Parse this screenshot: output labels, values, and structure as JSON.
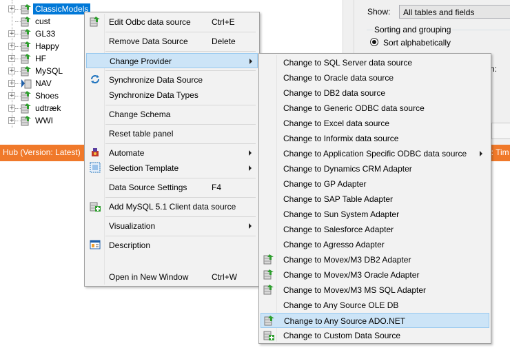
{
  "tree": {
    "items": [
      {
        "label": "ClassicModels",
        "expander": "+",
        "selected": true
      },
      {
        "label": "cust",
        "expander": "",
        "selected": false
      },
      {
        "label": "GL33",
        "expander": "+",
        "selected": false
      },
      {
        "label": "Happy",
        "expander": "+",
        "selected": false
      },
      {
        "label": "HF",
        "expander": "+",
        "selected": false
      },
      {
        "label": "MySQL",
        "expander": "+",
        "selected": false
      },
      {
        "label": "NAV",
        "expander": "+",
        "selected": false
      },
      {
        "label": "Shoes",
        "expander": "+",
        "selected": false
      },
      {
        "label": "udtræk",
        "expander": "+",
        "selected": false
      },
      {
        "label": "WWI",
        "expander": "+",
        "selected": false
      }
    ]
  },
  "right_panel": {
    "show_label": "Show:",
    "show_value": "All tables and fields",
    "sort_group_label": "Sorting and grouping",
    "sort_option": "Sort alphabetically",
    "clipped_text": "n:"
  },
  "status": {
    "left_text": "Hub (Version: Latest)",
    "right_text": "o: Tim"
  },
  "context_menu": {
    "items": [
      {
        "label": "Edit Odbc data source",
        "shortcut": "Ctrl+E",
        "icon": "edit-datasource-icon",
        "submenu": false
      },
      {
        "label": "Remove Data Source",
        "shortcut": "Delete",
        "icon": "",
        "submenu": false
      },
      {
        "label": "Change Provider",
        "shortcut": "",
        "icon": "",
        "submenu": true,
        "highlight": true
      },
      {
        "label": "Synchronize Data Source",
        "shortcut": "",
        "icon": "sync-icon",
        "submenu": false
      },
      {
        "label": "Synchronize Data Types",
        "shortcut": "",
        "icon": "",
        "submenu": false
      },
      {
        "label": "Change Schema",
        "shortcut": "",
        "icon": "",
        "submenu": false
      },
      {
        "label": "Reset table panel",
        "shortcut": "",
        "icon": "",
        "submenu": false
      },
      {
        "label": "Automate",
        "shortcut": "",
        "icon": "automate-icon",
        "submenu": true
      },
      {
        "label": "Selection Template",
        "shortcut": "",
        "icon": "selection-template-icon",
        "submenu": true
      },
      {
        "label": "Data Source Settings",
        "shortcut": "F4",
        "icon": "",
        "submenu": false
      },
      {
        "label": "Add MySQL 5.1 Client data source",
        "shortcut": "",
        "icon": "add-datasource-icon",
        "submenu": false
      },
      {
        "label": "Visualization",
        "shortcut": "",
        "icon": "",
        "submenu": true
      },
      {
        "label": "Description",
        "shortcut": "",
        "icon": "description-icon",
        "submenu": false
      },
      {
        "label": "Open in New Window",
        "shortcut": "Ctrl+W",
        "icon": "",
        "submenu": false
      }
    ]
  },
  "provider_submenu": {
    "items": [
      {
        "label": "Change to SQL Server data source",
        "icon": ""
      },
      {
        "label": "Change to Oracle data source",
        "icon": ""
      },
      {
        "label": "Change to DB2 data source",
        "icon": ""
      },
      {
        "label": "Change to Generic ODBC data source",
        "icon": ""
      },
      {
        "label": "Change to Excel data source",
        "icon": ""
      },
      {
        "label": "Change to Informix data source",
        "icon": ""
      },
      {
        "label": "Change to Application Specific ODBC data source",
        "icon": "",
        "submenu": true
      },
      {
        "label": "Change to Dynamics CRM Adapter",
        "icon": ""
      },
      {
        "label": "Change to GP Adapter",
        "icon": ""
      },
      {
        "label": "Change to SAP Table Adapter",
        "icon": ""
      },
      {
        "label": "Change to Sun System Adapter",
        "icon": ""
      },
      {
        "label": "Change to Salesforce Adapter",
        "icon": ""
      },
      {
        "label": "Change to Agresso Adapter",
        "icon": ""
      },
      {
        "label": "Change to Movex/M3 DB2 Adapter",
        "icon": "movex-db-icon"
      },
      {
        "label": "Change to Movex/M3 Oracle Adapter",
        "icon": "movex-db-icon"
      },
      {
        "label": "Change to Movex/M3 MS SQL Adapter",
        "icon": "movex-db-icon"
      },
      {
        "label": "Change to Any Source OLE DB",
        "icon": ""
      },
      {
        "label": "Change to Any Source ADO.NET",
        "icon": "ado-db-icon",
        "highlight": true
      },
      {
        "label": "Change to Custom Data Source",
        "icon": "custom-source-icon"
      }
    ]
  },
  "colors": {
    "status_orange": "#f0792a",
    "selection_blue": "#0078d7",
    "menu_highlight": "#cce4f7"
  }
}
